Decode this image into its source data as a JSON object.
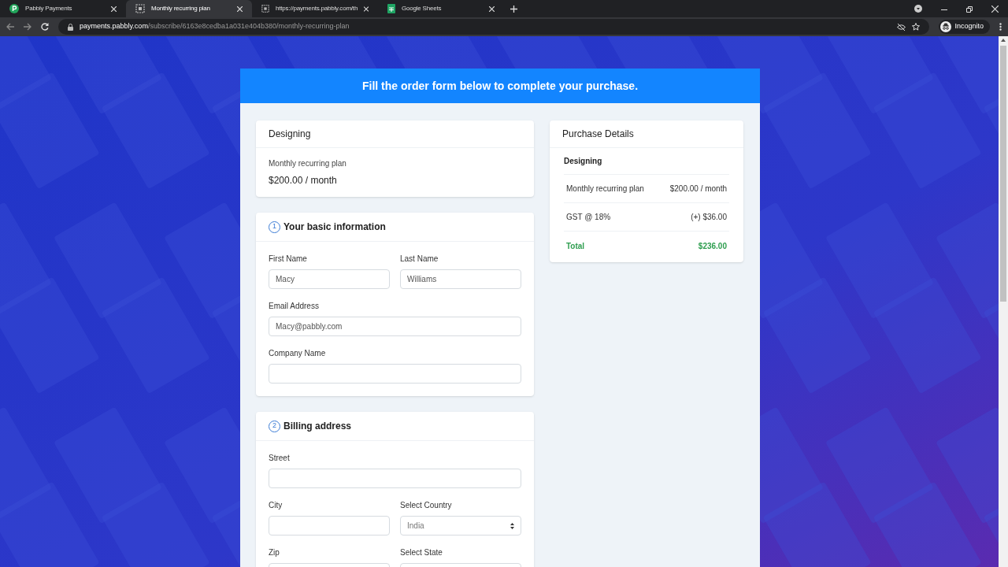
{
  "browser": {
    "tabs": [
      {
        "title": "Pabbly Payments",
        "kind": "pabbly",
        "selected": false
      },
      {
        "title": "Monthly recurring plan",
        "kind": "page",
        "selected": true
      },
      {
        "title": "https://payments.pabbly.com/th",
        "kind": "page",
        "selected": false
      },
      {
        "title": "Google Sheets",
        "kind": "sheets",
        "selected": false
      }
    ],
    "url_host": "payments.pabbly.com",
    "url_path": "/subscribe/6163e8cedba1a031e404b380/monthly-recurring-plan",
    "profile": "Incognito"
  },
  "banner": "Fill the order form below to complete your purchase.",
  "plan_card": {
    "title": "Designing",
    "plan": "Monthly recurring plan",
    "price": "$200.00 / month"
  },
  "sections": [
    {
      "number": "1",
      "title": "Your basic information",
      "rows": [
        [
          {
            "label": "First Name",
            "value": "Macy",
            "kind": "input"
          },
          {
            "label": "Last Name",
            "value": "Williams",
            "kind": "input"
          }
        ],
        [
          {
            "label": "Email Address",
            "value": "Macy@pabbly.com",
            "kind": "input"
          }
        ],
        [
          {
            "label": "Company Name",
            "kind": "input"
          }
        ]
      ]
    },
    {
      "number": "2",
      "title": "Billing address",
      "rows": [
        [
          {
            "label": "Street",
            "kind": "input"
          }
        ],
        [
          {
            "label": "City",
            "kind": "input"
          },
          {
            "label": "Select Country",
            "value": "India",
            "kind": "select"
          }
        ],
        [
          {
            "label": "Zip",
            "kind": "input"
          },
          {
            "label": "Select State",
            "kind": "input"
          }
        ]
      ]
    }
  ],
  "purchase": {
    "title": "Purchase Details",
    "product": "Designing",
    "lines": [
      {
        "label": "Monthly recurring plan",
        "amount": "$200.00 / month",
        "kind": "item"
      },
      {
        "label": "GST @ 18%",
        "amount": "(+) $36.00",
        "kind": "item"
      },
      {
        "label": "Total",
        "amount": "$236.00",
        "kind": "total"
      }
    ]
  }
}
